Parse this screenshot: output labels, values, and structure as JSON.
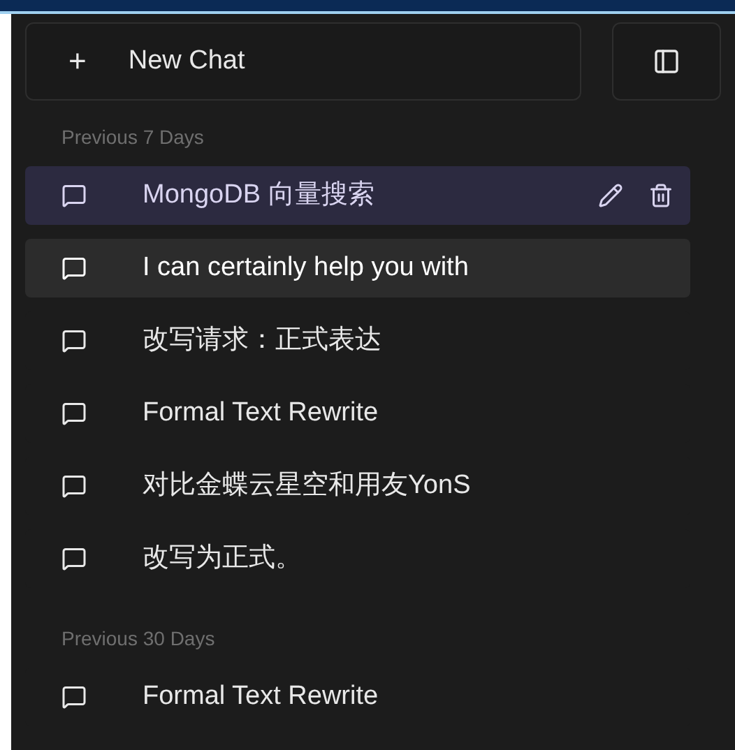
{
  "new_chat_button": {
    "label": "New Chat",
    "icon": "+"
  },
  "sections": [
    {
      "label": "Previous 7 Days",
      "chats": [
        {
          "title": "MongoDB 向量搜索",
          "selected": true,
          "hovered": false
        },
        {
          "title": "I can certainly help you with",
          "selected": false,
          "hovered": true
        },
        {
          "title": "改写请求：正式表达",
          "selected": false,
          "hovered": false
        },
        {
          "title": "Formal Text Rewrite",
          "selected": false,
          "hovered": false
        },
        {
          "title": "对比金蝶云星空和用友YonS",
          "selected": false,
          "hovered": false
        },
        {
          "title": "改写为正式。",
          "selected": false,
          "hovered": false
        }
      ]
    },
    {
      "label": "Previous 30 Days",
      "chats": [
        {
          "title": "Formal Text Rewrite",
          "selected": false,
          "hovered": false
        }
      ]
    }
  ]
}
